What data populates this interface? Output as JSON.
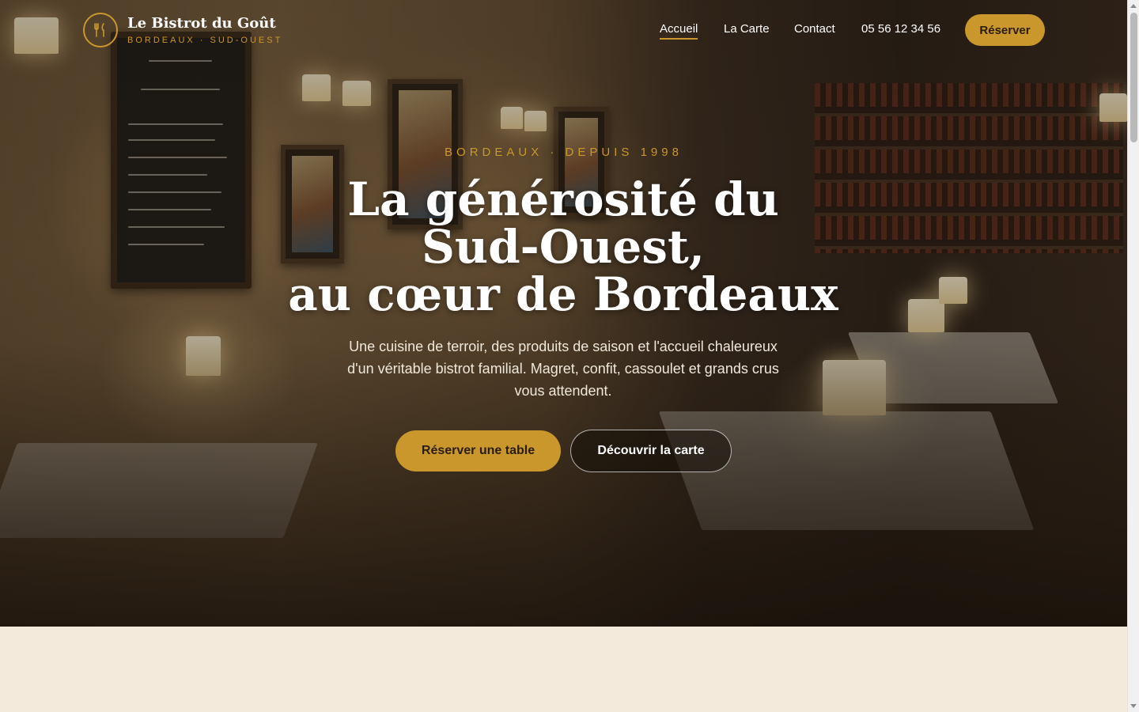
{
  "brand": {
    "name": "Le Bistrot du Goût",
    "tagline": "BORDEAUX · SUD-OUEST",
    "icon": "fork-knife-icon",
    "accent_color": "#c9972b"
  },
  "nav": {
    "items": [
      {
        "label": "Accueil",
        "active": true
      },
      {
        "label": "La Carte",
        "active": false
      },
      {
        "label": "Contact",
        "active": false
      }
    ],
    "phone": "05 56 12 34 56",
    "reserve_label": "Réserver"
  },
  "hero": {
    "eyebrow": "BORDEAUX · DEPUIS 1998",
    "headline_line1": "La générosité du Sud-Ouest,",
    "headline_line2": "au cœur de Bordeaux",
    "lead": "Une cuisine de terroir, des produits de saison et l'accueil chaleureux d'un véritable bistrot familial. Magret, confit, cassoulet et grands crus vous attendent.",
    "primary_cta": "Réserver une table",
    "secondary_cta": "Découvrir la carte"
  },
  "colors": {
    "cream_background": "#f3eadc",
    "button_text": "#2a1e10"
  }
}
